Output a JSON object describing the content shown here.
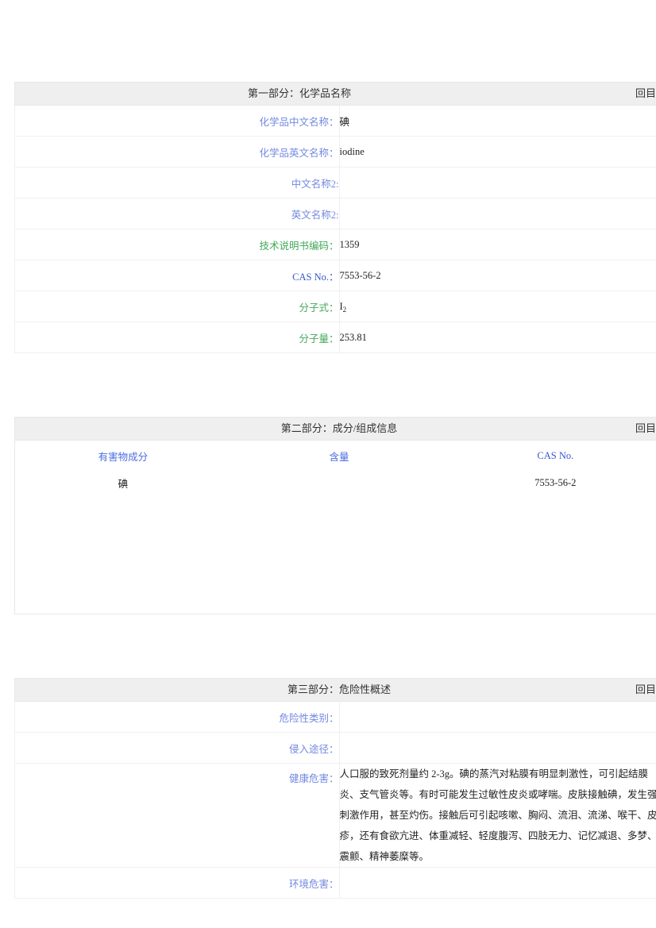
{
  "sections": [
    {
      "id": "section-1",
      "title": "第一部分：化学品名称",
      "back_link": "回目录",
      "rows": [
        {
          "label": "化学品中文名称：",
          "value": "碘",
          "color": "blue"
        },
        {
          "label": "化学品英文名称：",
          "value": "iodine",
          "color": "blue"
        },
        {
          "label": "中文名称2:",
          "value": "",
          "color": "blue"
        },
        {
          "label": "英文名称2:",
          "value": "",
          "color": "blue"
        },
        {
          "label": "技术说明书编码：",
          "value": "1359",
          "color": "green"
        },
        {
          "label": "CAS No.：",
          "value": "7553-56-2",
          "color": "casno"
        },
        {
          "label": "分子式：",
          "value": "I2",
          "color": "green"
        },
        {
          "label": "分子量：",
          "value": "253.81",
          "color": "green"
        }
      ]
    },
    {
      "id": "section-2",
      "title": "第二部分：成分/组成信息",
      "back_link": "回目录",
      "columns": [
        "有害物成分",
        "含量",
        "CAS No."
      ],
      "rows": [
        {
          "component": "碘",
          "content": "",
          "cas": "7553-56-2"
        }
      ]
    },
    {
      "id": "section-3",
      "title": "第三部分：危险性概述",
      "back_link": "回目录",
      "rows": [
        {
          "label": "危险性类别：",
          "value": "",
          "color": "blue"
        },
        {
          "label": "侵入途径：",
          "value": "",
          "color": "blue"
        },
        {
          "label": "健康危害：",
          "value": "人口服的致死剂量约 2-3g。碘的蒸汽对粘膜有明显刺激性，可引起结膜炎、支气管炎等。有时可能发生过敏性皮炎或哮喘。皮肤接触碘，发生强刺激作用，甚至灼伤。接触后可引起咳嗽、胸闷、流泪、流涕、喉干、皮疹，还有食欲亢进、体重减轻、轻度腹泻、四肢无力、记忆减退、多梦、震颤、精神萎糜等。",
          "color": "blue",
          "tall": true
        },
        {
          "label": "环境危害：",
          "value": "",
          "color": "blue"
        }
      ]
    }
  ],
  "colors": {
    "label_blue": "#7289e0",
    "label_green": "#42a75a",
    "label_casno": "#3a57cf",
    "header_bg": "#efefef",
    "text": "#222222"
  }
}
